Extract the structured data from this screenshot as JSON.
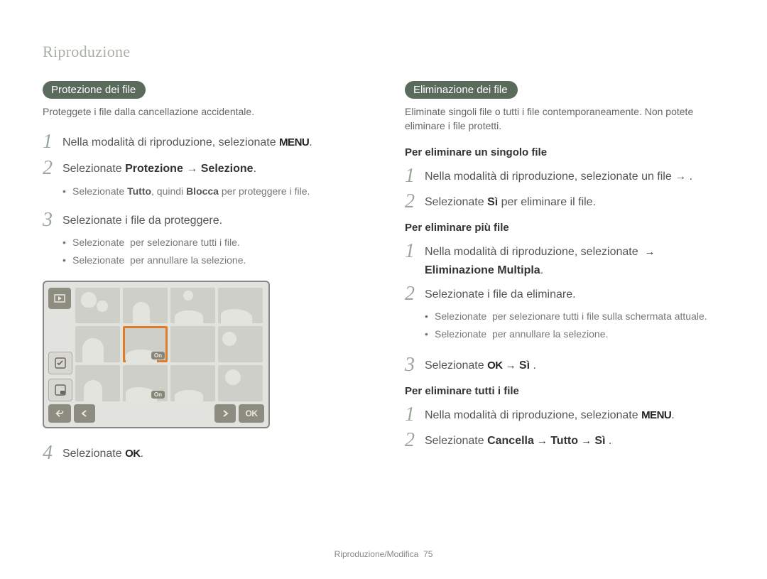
{
  "page_title": "Riproduzione",
  "footer": {
    "section": "Riproduzione/Modifica",
    "page_num": "75"
  },
  "icons": {
    "menu": "MENU",
    "ok": "OK",
    "arrow": "→",
    "trash": "trash-icon",
    "checkall": "select-all-icon",
    "uncheck": "deselect-all-icon"
  },
  "left": {
    "badge": "Protezione dei file",
    "desc": "Proteggete i file dalla cancellazione accidentale.",
    "steps": [
      {
        "num": "1",
        "pre": "Nella modalità di riproduzione, selezionate ",
        "icon": "menu",
        "post": "."
      },
      {
        "num": "2",
        "pre": "Selezionate ",
        "bold1": "Protezione",
        "mid": " → ",
        "bold2": "Selezione",
        "post": "."
      },
      {
        "num": "2b",
        "bullets": [
          {
            "pre": "Selezionate ",
            "b1": "Tutto",
            "mid": ", quindi ",
            "b2": "Blocca",
            "post": " per proteggere i file."
          }
        ]
      },
      {
        "num": "3",
        "pre": "Selezionate i file da proteggere."
      },
      {
        "num": "3b",
        "bullets": [
          {
            "pre": "Selezionate ",
            "icon": "checkall",
            "post": " per selezionare tutti i file."
          },
          {
            "pre": "Selezionate ",
            "icon": "uncheck",
            "post": " per annullare la selezione."
          }
        ]
      },
      {
        "num": "4",
        "pre": "Selezionate ",
        "icon": "ok",
        "post": "."
      }
    ]
  },
  "screenshot": {
    "on_label": "On",
    "ok_label": "OK"
  },
  "right": {
    "badge": "Eliminazione dei file",
    "desc": "Eliminate singoli file o tutti i file contemporaneamente. Non potete eliminare i file protetti.",
    "sub_single": "Per eliminare un singolo file",
    "single_steps": [
      {
        "num": "1",
        "pre": "Nella modalità di riproduzione, selezionate un file → ",
        "icon": "trash",
        "post": "."
      },
      {
        "num": "2",
        "pre": "Selezionate ",
        "bold1": "Sì",
        "post": " per eliminare il file."
      }
    ],
    "sub_multi": "Per eliminare più file",
    "multi_steps": [
      {
        "num": "1",
        "pre": "Nella modalità di riproduzione, selezionate ",
        "icon": "trash",
        "mid": " → ",
        "bold1": "Eliminazione Multipla",
        "post": "."
      },
      {
        "num": "2",
        "pre": "Selezionate i file da eliminare."
      },
      {
        "num": "2b",
        "bullets": [
          {
            "pre": "Selezionate ",
            "icon": "checkall",
            "post": " per selezionare tutti i file sulla schermata attuale."
          },
          {
            "pre": "Selezionate ",
            "icon": "uncheck",
            "post": " per annullare la selezione."
          }
        ]
      },
      {
        "num": "3",
        "pre": "Selezionate ",
        "icon": "ok",
        "mid": " → ",
        "bold1": "Sì",
        "post": " ."
      }
    ],
    "sub_all": "Per eliminare tutti i file",
    "all_steps": [
      {
        "num": "1",
        "pre": "Nella modalità di riproduzione, selezionate ",
        "icon": "menu",
        "post": "."
      },
      {
        "num": "2",
        "pre": "Selezionate ",
        "bold1": "Cancella",
        "mid1": " → ",
        "bold2": "Tutto",
        "mid2": " → ",
        "bold3": "Sì",
        "post": " ."
      }
    ]
  }
}
